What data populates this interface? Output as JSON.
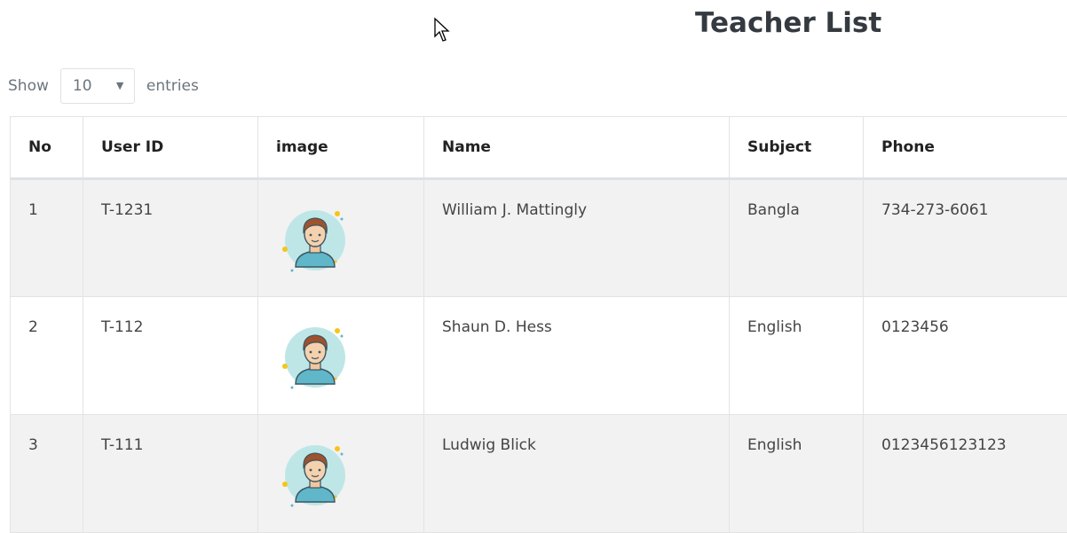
{
  "page": {
    "title": "Teacher List"
  },
  "length_menu": {
    "show_label": "Show",
    "selected": "10",
    "entries_label": "entries"
  },
  "table": {
    "headers": [
      "No",
      "User ID",
      "image",
      "Name",
      "Subject",
      "Phone"
    ],
    "rows": [
      {
        "no": "1",
        "user_id": "T-1231",
        "image": "avatar-icon",
        "name": "William J. Mattingly",
        "subject": "Bangla",
        "phone": "734-273-6061"
      },
      {
        "no": "2",
        "user_id": "T-112",
        "image": "avatar-icon",
        "name": "Shaun D. Hess",
        "subject": "English",
        "phone": "0123456"
      },
      {
        "no": "3",
        "user_id": "T-111",
        "image": "avatar-icon",
        "name": "Ludwig Blick",
        "subject": "English",
        "phone": "0123456123123"
      }
    ]
  },
  "colors": {
    "avatar_bg": "#bfe6e6",
    "avatar_shirt": "#5fb7c9",
    "hair": "#a0522d",
    "dot_yellow": "#f5c518",
    "row_stripe": "#f2f2f2"
  }
}
